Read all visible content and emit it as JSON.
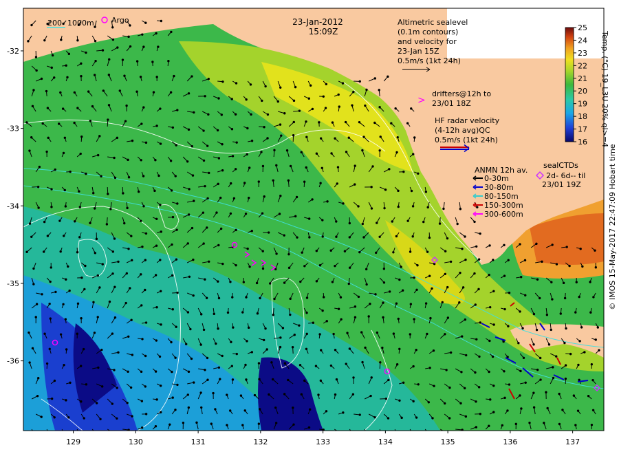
{
  "header": {
    "date": "23-Jan-2012",
    "time": "15:09Z"
  },
  "scale_legend": {
    "depth_200": "200",
    "depth_1000": "1000m",
    "argo_label": "Argo"
  },
  "altimetry": {
    "lines": [
      "Altimetric sealevel",
      "(0.1m contours)",
      "and velocity for",
      "23-Jan 15Z",
      "0.5m/s (1kt 24h)"
    ]
  },
  "drifters": {
    "symbol": ">",
    "lines": [
      "drifters@12h to",
      "23/01 18Z"
    ]
  },
  "hf_radar": {
    "lines": [
      "HF radar velocity",
      "(4-12h avg)QC",
      "0.5m/s (1kt 24h)"
    ]
  },
  "anmn": {
    "title": "ANMN 12h av.",
    "items": [
      {
        "label": "0-30m",
        "color": "#000000"
      },
      {
        "label": "30-80m",
        "color": "#0000cc"
      },
      {
        "label": "80-150m",
        "color": "#33cccc"
      },
      {
        "label": "150-300m",
        "color": "#cc0000"
      },
      {
        "label": "300-600m",
        "color": "#ff00ff"
      }
    ]
  },
  "seal_ctds": {
    "title": "sealCTDs",
    "lines": [
      "2d- 6d-- til",
      "23/01 19Z"
    ]
  },
  "colorbar": {
    "label": "Temp. (°C) 19_L3U 20% ql>=4",
    "ticks": [
      "25",
      "24",
      "23",
      "22",
      "21",
      "20",
      "19",
      "18",
      "17",
      "16"
    ],
    "min": 16,
    "max": 25
  },
  "axes": {
    "x_ticks": [
      "129",
      "130",
      "131",
      "132",
      "133",
      "134",
      "135",
      "136",
      "137"
    ],
    "y_ticks": [
      "-32",
      "-33",
      "-34",
      "-35",
      "-36"
    ],
    "x_range": [
      128.2,
      137.5
    ],
    "y_range": [
      -36.9,
      -31.45
    ]
  },
  "credit": "© IMOS 15-May-2017 22:47:09 Hobart time",
  "colors": {
    "land": "#f9c9a0",
    "ocean_warm": "#9acd32",
    "ocean_cool": "#20b2aa",
    "cold_core": "#0a0a80"
  }
}
